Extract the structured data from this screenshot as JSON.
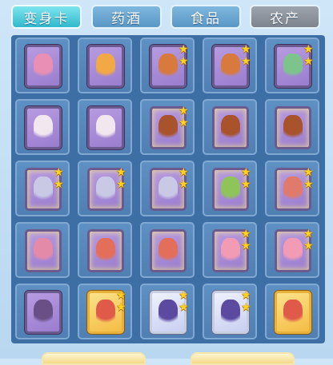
{
  "tabs": [
    {
      "label": "变身卡",
      "active": true
    },
    {
      "label": "药酒",
      "active": false
    },
    {
      "label": "食品",
      "active": false
    },
    {
      "label": "农产",
      "active": false
    }
  ],
  "colors": {
    "active_tab": "#2fb9cd",
    "tab": "#5a97c6",
    "disabled_tab": "#7d848d",
    "grid_bg": "#3d6fa5",
    "card_purple": "#9a7dcf",
    "card_gold": "#f4bd45",
    "star": "#ffd21f"
  },
  "inventory": [
    {
      "icon": "pig-transformation-card-icon",
      "frame": "purple",
      "stars": 0,
      "glow": false
    },
    {
      "icon": "dragon-transformation-card-icon",
      "frame": "purple",
      "stars": 0,
      "glow": false
    },
    {
      "icon": "fox-transformation-card-icon",
      "frame": "purple",
      "stars": 2,
      "glow": false
    },
    {
      "icon": "fox-transformation-card-icon",
      "frame": "purple",
      "stars": 2,
      "glow": false
    },
    {
      "icon": "fairy-transformation-card-icon",
      "frame": "purple",
      "stars": 2,
      "glow": false
    },
    {
      "icon": "winged-maiden-transformation-card-icon",
      "frame": "purple",
      "stars": 0,
      "glow": false
    },
    {
      "icon": "winged-maiden-transformation-card-icon",
      "frame": "purple",
      "stars": 0,
      "glow": false
    },
    {
      "icon": "warrior-transformation-card-icon",
      "frame": "purple",
      "stars": 2,
      "glow": true
    },
    {
      "icon": "warrior-transformation-card-icon",
      "frame": "purple",
      "stars": 0,
      "glow": true
    },
    {
      "icon": "warrior-transformation-card-icon",
      "frame": "purple",
      "stars": 0,
      "glow": true
    },
    {
      "icon": "white-haired-general-transformation-card-icon",
      "frame": "purple",
      "stars": 2,
      "glow": true
    },
    {
      "icon": "white-haired-general-transformation-card-icon",
      "frame": "purple",
      "stars": 2,
      "glow": true
    },
    {
      "icon": "white-haired-general-transformation-card-icon",
      "frame": "purple",
      "stars": 2,
      "glow": true
    },
    {
      "icon": "green-dancer-transformation-card-icon",
      "frame": "purple",
      "stars": 2,
      "glow": true
    },
    {
      "icon": "feathered-spirit-transformation-card-icon",
      "frame": "purple",
      "stars": 2,
      "glow": true
    },
    {
      "icon": "winged-archer-transformation-card-icon",
      "frame": "purple",
      "stars": 0,
      "glow": true
    },
    {
      "icon": "red-haired-fighter-transformation-card-icon",
      "frame": "purple",
      "stars": 0,
      "glow": true
    },
    {
      "icon": "red-haired-fighter-transformation-card-icon",
      "frame": "purple",
      "stars": 0,
      "glow": true
    },
    {
      "icon": "pink-fairy-transformation-card-icon",
      "frame": "purple",
      "stars": 2,
      "glow": true
    },
    {
      "icon": "pink-fairy-transformation-card-icon",
      "frame": "purple",
      "stars": 2,
      "glow": true
    },
    {
      "icon": "armored-knight-transformation-card-icon",
      "frame": "purple",
      "stars": 0,
      "glow": false
    },
    {
      "icon": "red-haired-mage-transformation-card-icon",
      "frame": "gold",
      "stars": 2,
      "glow": true
    },
    {
      "icon": "purple-ninja-transformation-card-icon",
      "frame": "silver",
      "stars": 2,
      "glow": true
    },
    {
      "icon": "purple-ninja-transformation-card-icon",
      "frame": "silver",
      "stars": 2,
      "glow": true
    },
    {
      "icon": "red-haired-mage-transformation-card-icon",
      "frame": "gold",
      "stars": 0,
      "glow": true
    }
  ]
}
